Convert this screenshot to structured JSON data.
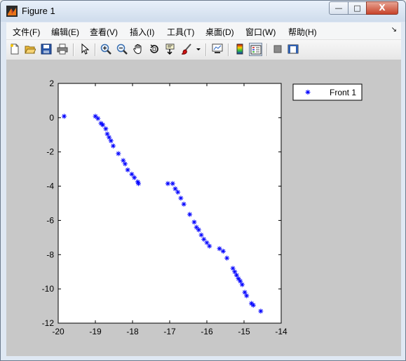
{
  "window": {
    "title": "Figure 1"
  },
  "window_controls": {
    "minimize": "—",
    "maximize": "□",
    "close": "X"
  },
  "menubar": {
    "items": [
      "文件(F)",
      "编辑(E)",
      "查看(V)",
      "插入(I)",
      "工具(T)",
      "桌面(D)",
      "窗口(W)",
      "帮助(H)"
    ],
    "overflow_arrow": "↘"
  },
  "toolbar": {
    "icons": [
      "new-figure-icon",
      "open-file-icon",
      "save-icon",
      "print-icon",
      "arrow-select-icon",
      "zoom-in-icon",
      "zoom-out-icon",
      "pan-hand-icon",
      "rotate-3d-icon",
      "data-cursor-icon",
      "brush-icon",
      "link-plot-icon",
      "colorbar-icon",
      "legend-icon",
      "hide-plot-tools-icon",
      "show-plot-tools-icon"
    ]
  },
  "colors": {
    "marker": "#0000ff",
    "figure_background": "#c8c8c8",
    "axes_background": "#ffffff"
  },
  "chart_data": {
    "type": "scatter",
    "marker": "*",
    "xlim": [
      -20,
      -14
    ],
    "ylim": [
      -12,
      2
    ],
    "xticks": [
      -20,
      -19,
      -18,
      -17,
      -16,
      -15,
      -14
    ],
    "yticks": [
      2,
      0,
      -2,
      -4,
      -6,
      -8,
      -10,
      -12
    ],
    "grid": false,
    "legend_position": "outside-top-right",
    "series": [
      {
        "name": "Front 1",
        "points": [
          [
            -19.84,
            0.08
          ],
          [
            -19.0,
            0.08
          ],
          [
            -18.93,
            -0.05
          ],
          [
            -18.85,
            -0.33
          ],
          [
            -18.8,
            -0.42
          ],
          [
            -18.72,
            -0.65
          ],
          [
            -18.68,
            -0.95
          ],
          [
            -18.63,
            -1.15
          ],
          [
            -18.58,
            -1.35
          ],
          [
            -18.52,
            -1.65
          ],
          [
            -18.38,
            -2.1
          ],
          [
            -18.25,
            -2.5
          ],
          [
            -18.2,
            -2.7
          ],
          [
            -18.13,
            -3.05
          ],
          [
            -18.02,
            -3.3
          ],
          [
            -17.95,
            -3.5
          ],
          [
            -17.86,
            -3.75
          ],
          [
            -17.84,
            -3.85
          ],
          [
            -17.05,
            -3.85
          ],
          [
            -16.92,
            -3.85
          ],
          [
            -16.85,
            -4.15
          ],
          [
            -16.78,
            -4.35
          ],
          [
            -16.7,
            -4.7
          ],
          [
            -16.62,
            -5.05
          ],
          [
            -16.46,
            -5.65
          ],
          [
            -16.34,
            -6.1
          ],
          [
            -16.28,
            -6.4
          ],
          [
            -16.22,
            -6.55
          ],
          [
            -16.15,
            -6.85
          ],
          [
            -16.08,
            -7.1
          ],
          [
            -16.0,
            -7.3
          ],
          [
            -15.93,
            -7.5
          ],
          [
            -15.66,
            -7.65
          ],
          [
            -15.56,
            -7.8
          ],
          [
            -15.46,
            -8.2
          ],
          [
            -15.3,
            -8.8
          ],
          [
            -15.25,
            -9.0
          ],
          [
            -15.2,
            -9.2
          ],
          [
            -15.15,
            -9.4
          ],
          [
            -15.1,
            -9.55
          ],
          [
            -15.05,
            -9.75
          ],
          [
            -14.98,
            -10.2
          ],
          [
            -14.93,
            -10.4
          ],
          [
            -14.8,
            -10.85
          ],
          [
            -14.75,
            -10.95
          ],
          [
            -14.55,
            -11.3
          ]
        ]
      }
    ]
  }
}
